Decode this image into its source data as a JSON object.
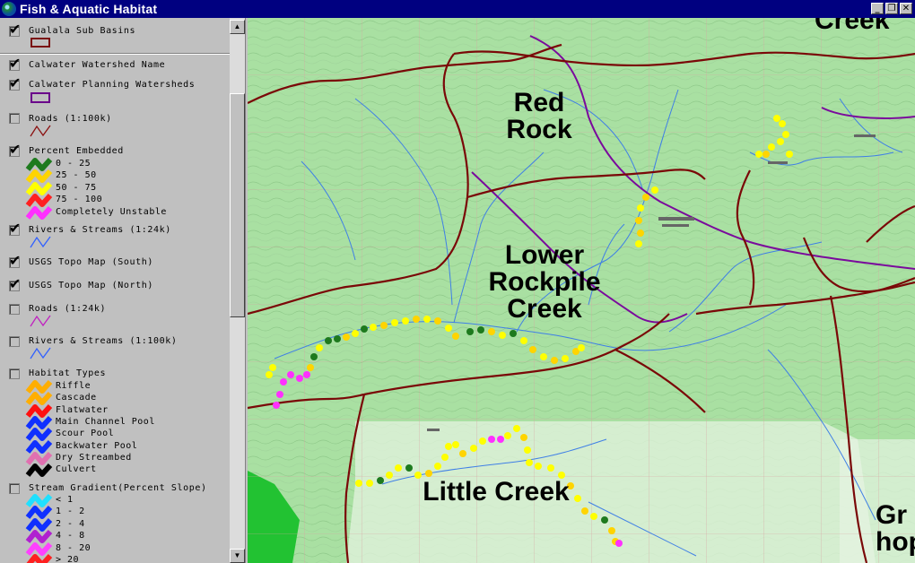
{
  "window": {
    "title": "Fish & Aquatic Habitat",
    "controls": {
      "minimize": "_",
      "restore": "❐",
      "close": "✕"
    }
  },
  "legend": {
    "layers": [
      {
        "label": "Gualala Sub Basins",
        "checked": true
      },
      {
        "label": "Calwater Watershed Name",
        "checked": true
      },
      {
        "label": "Calwater Planning Watersheds",
        "checked": true
      },
      {
        "label": "Roads (1:100k)",
        "checked": false
      },
      {
        "label": "Percent Embedded",
        "checked": true
      },
      {
        "label": "Rivers & Streams (1:24k)",
        "checked": true
      },
      {
        "label": "USGS Topo Map (South)",
        "checked": true
      },
      {
        "label": "USGS Topo Map (North)",
        "checked": true
      },
      {
        "label": "Roads (1:24k)",
        "checked": false
      },
      {
        "label": "Rivers & Streams (1:100k)",
        "checked": false
      },
      {
        "label": "Habitat Types",
        "checked": false
      },
      {
        "label": "Stream Gradient(Percent Slope)",
        "checked": false
      }
    ],
    "percent_embedded": [
      {
        "label": "0 - 25",
        "color": "#1e7a1e"
      },
      {
        "label": "25 - 50",
        "color": "#ffd400"
      },
      {
        "label": "50 - 75",
        "color": "#ffff00"
      },
      {
        "label": "75 - 100",
        "color": "#ff2020"
      },
      {
        "label": "Completely Unstable",
        "color": "#ff30ff"
      }
    ],
    "habitat_types": [
      {
        "label": "Riffle",
        "color": "#ffae00"
      },
      {
        "label": "Cascade",
        "color": "#ffae00"
      },
      {
        "label": "Flatwater",
        "color": "#ff1010"
      },
      {
        "label": "Main Channel Pool",
        "color": "#1030ff"
      },
      {
        "label": "Scour Pool",
        "color": "#1030ff"
      },
      {
        "label": "Backwater Pool",
        "color": "#1030ff"
      },
      {
        "label": "Dry Streambed",
        "color": "#e070b0"
      },
      {
        "label": "Culvert",
        "color": "#000000"
      }
    ],
    "stream_gradient": [
      {
        "label": "< 1",
        "color": "#20e0ff"
      },
      {
        "label": "1 - 2",
        "color": "#1030ff"
      },
      {
        "label": "2 - 4",
        "color": "#1030ff"
      },
      {
        "label": "4 - 8",
        "color": "#b020d0"
      },
      {
        "label": "8 - 20",
        "color": "#ff40ff"
      },
      {
        "label": "> 20",
        "color": "#ff2020"
      }
    ]
  },
  "map": {
    "labels": [
      {
        "text": "Creek"
      },
      {
        "text": "Red\nRock"
      },
      {
        "text": "Lower\nRockpile\nCreek"
      },
      {
        "text": "Little Creek"
      },
      {
        "text": "Gr\nhop"
      }
    ]
  }
}
